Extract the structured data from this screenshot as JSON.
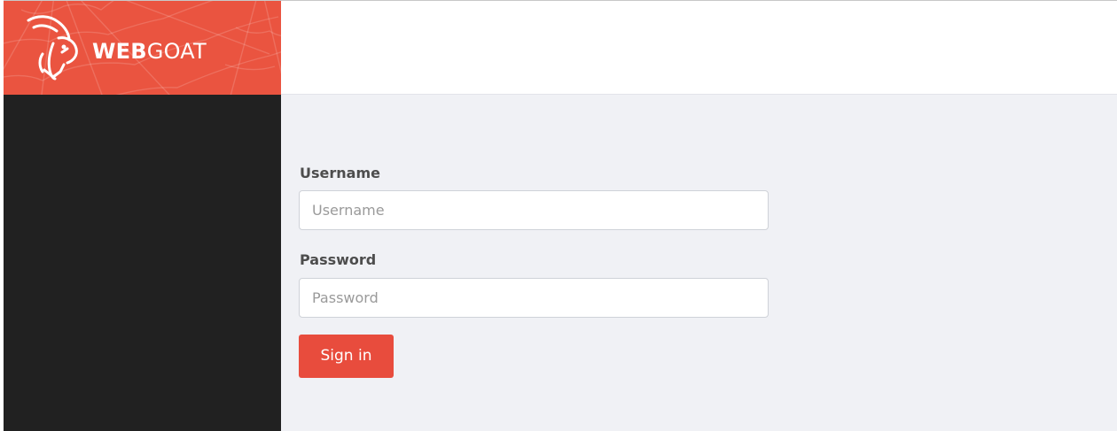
{
  "brand": {
    "name_bold": "WEB",
    "name_light": "GOAT",
    "logo_icon": "goat-head-icon",
    "color": "#ea5440"
  },
  "login_form": {
    "username_label": "Username",
    "username_placeholder": "Username",
    "username_value": "",
    "password_label": "Password",
    "password_placeholder": "Password",
    "password_value": "",
    "submit_label": "Sign in",
    "submit_color": "#e84c3d"
  },
  "colors": {
    "sidebar": "#212121",
    "main_background": "#f0f1f5",
    "header_background": "#ffffff"
  }
}
